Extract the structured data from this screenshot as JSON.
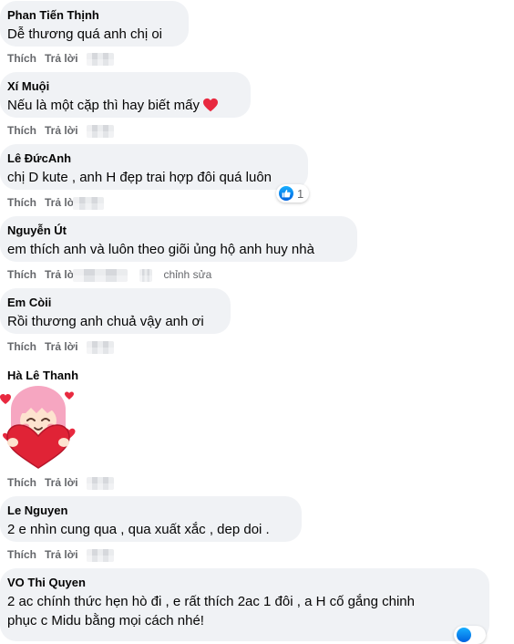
{
  "actions": {
    "like": "Thích",
    "reply": "Trả lời",
    "edited": "chỉnh sửa"
  },
  "comments": [
    {
      "author": "Phan Tiến Thịnh",
      "text": "Dễ thương quá anh chị oi"
    },
    {
      "author": "Xí Muội",
      "text": "Nếu là một cặp thì hay biết mấy",
      "emoji": "red-heart"
    },
    {
      "author": "Lê ĐứcAnh",
      "text": "chị D kute , anh H đẹp trai hợp đôi quá luôn",
      "reactions": {
        "icon": "like-icon",
        "count": "1"
      }
    },
    {
      "author": "Nguyễn Út",
      "text": "em thích anh và luôn theo giõi ủng hộ anh huy nhà"
    },
    {
      "author": "Em Còii",
      "text": "Rồi thương anh chuả vậy anh ơi"
    },
    {
      "author": "Hà Lê Thanh",
      "sticker": "girl-hugging-heart-sticker"
    },
    {
      "author": "Le Nguyen",
      "text": "2 e nhìn cung qua , qua xuất xắc , dep doi ."
    },
    {
      "author": "VO Thi Quyen",
      "text_lines": [
        "2 ac chính thức hẹn hò đi , e rất thích 2ac 1 đôi , a H cố gắng chinh",
        "phục c Midu bằng mọi cách nhé!"
      ]
    }
  ],
  "colors": {
    "bubble": "#f0f2f5",
    "action_text": "#65676b",
    "like_blue": "#1877f2",
    "heart_red": "#f33e58"
  }
}
